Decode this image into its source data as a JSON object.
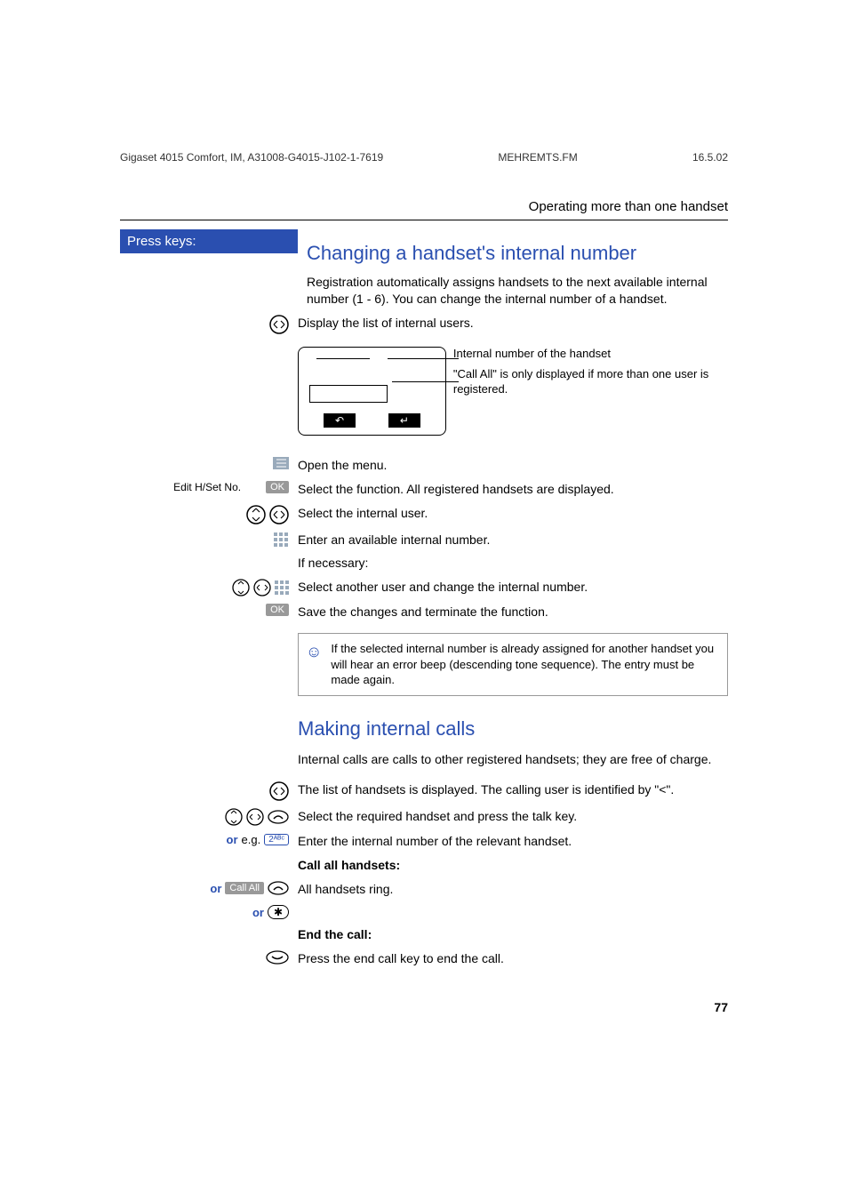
{
  "header": {
    "doc_id": "Gigaset 4015 Comfort, IM, A31008-G4015-J102-1-7619",
    "file": "MEHREMTS.FM",
    "date": "16.5.02"
  },
  "section_title": "Operating more than one handset",
  "press_keys_label": "Press keys:",
  "heading1": "Changing a handset's internal number",
  "intro1": "Registration automatically assigns handsets to the next available internal number (1 - 6). You can change the internal number of a handset.",
  "step_display_list": "Display the list of internal users.",
  "display_callout1": "Internal number of the handset",
  "display_callout2": "\"Call All\" is only displayed if more than one user is registered.",
  "step_open_menu": "Open the menu.",
  "edit_hset_label": "Edit H/Set No.",
  "ok_label": "OK",
  "step_select_function": "Select the function. All registered handsets are displayed.",
  "step_select_user": "Select the internal user.",
  "step_enter_number": "Enter an available internal number.",
  "if_necessary": "If necessary:",
  "step_select_another": "Select another user and change the internal number.",
  "step_save": "Save the changes and terminate the function.",
  "note_text": "If the selected internal number is already assigned for another handset you will hear an error beep (descending tone sequence). The entry must be made again.",
  "heading2": "Making internal calls",
  "intro2": "Internal calls are calls to other registered handsets; they are free of charge.",
  "step_list_handsets": "The list of handsets is displayed. The calling user is identified by \"<\".",
  "step_select_required": "Select the required handset and press the talk key.",
  "or_label": "or",
  "eg_label": "e.g.",
  "key2_label": "2ᴬᴮᶜ",
  "step_enter_internal": "Enter the internal number of the relevant handset.",
  "call_all_heading": "Call all handsets:",
  "call_all_btn": "Call All",
  "step_all_ring": "All handsets ring.",
  "star_label": "✱",
  "end_call_heading": "End the call:",
  "step_end_call": "Press the end call key to end the call.",
  "softkey_left": "↶",
  "softkey_right": "↵",
  "page_number": "77"
}
